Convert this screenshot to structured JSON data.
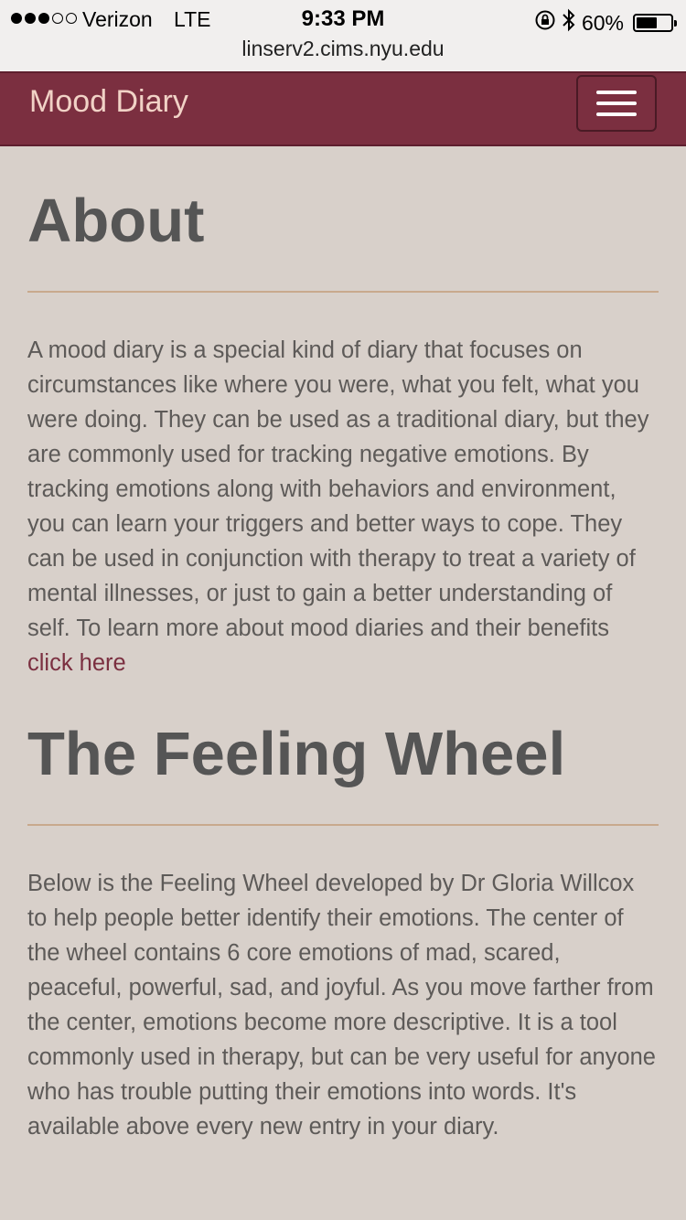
{
  "status_bar": {
    "carrier": "Verizon",
    "network": "LTE",
    "time": "9:33 PM",
    "battery_percent": "60%",
    "battery_level": 0.6
  },
  "browser": {
    "url": "linserv2.cims.nyu.edu"
  },
  "navbar": {
    "brand": "Mood Diary",
    "bg_color": "#7b2f40",
    "brand_color": "#f1d2c6"
  },
  "about": {
    "heading": "About",
    "body": "A mood diary is a special kind of diary that focuses on circumstances like where you were, what you felt, what you were doing. They can be used as a traditional diary, but they are commonly used for tracking negative emotions. By tracking emotions along with behaviors and environment, you can learn your triggers and better ways to cope. They can be used in conjunction with therapy to treat a variety of mental illnesses, or just to gain a better understanding of self. To learn more about mood diaries and their benefits",
    "link_text": "click here"
  },
  "feeling_wheel": {
    "heading": "The Feeling Wheel",
    "body": "Below is the Feeling Wheel developed by Dr Gloria Willcox to help people better identify their emotions. The center of the wheel contains 6 core emotions of mad, scared, peaceful, powerful, sad, and joyful. As you move farther from the center, emotions become more descriptive. It is a tool commonly used in therapy, but can be very useful for anyone who has trouble putting their emotions into words. It's available above every new entry in your diary."
  },
  "icons": {
    "signal": "signal-dots-icon",
    "lock": "rotation-lock-icon",
    "bluetooth": "bluetooth-icon",
    "battery": "battery-icon",
    "menu": "hamburger-menu-icon"
  }
}
